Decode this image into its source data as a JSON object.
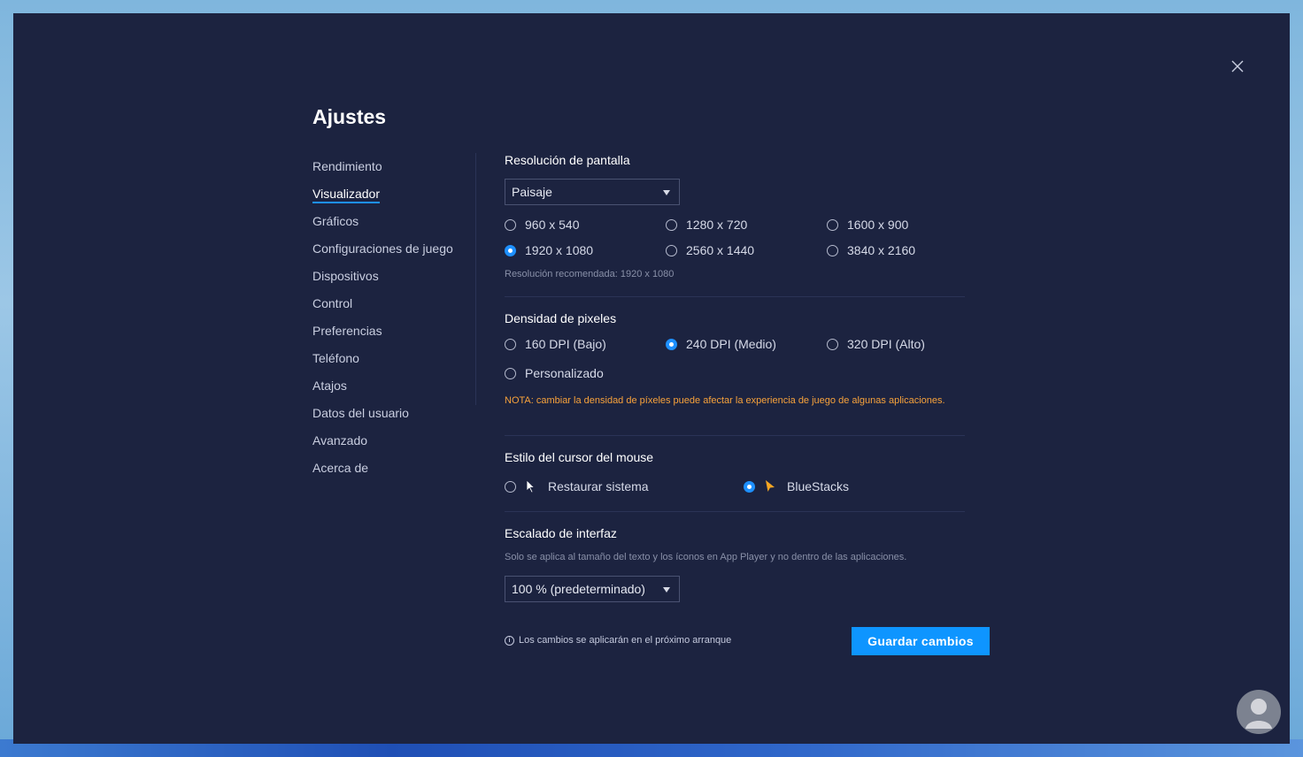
{
  "window": {
    "title": "Ajustes"
  },
  "sidebar": {
    "items": [
      {
        "label": "Rendimiento",
        "active": false
      },
      {
        "label": "Visualizador",
        "active": true
      },
      {
        "label": "Gráficos",
        "active": false
      },
      {
        "label": "Configuraciones de juego",
        "active": false
      },
      {
        "label": "Dispositivos",
        "active": false
      },
      {
        "label": "Control",
        "active": false
      },
      {
        "label": "Preferencias",
        "active": false
      },
      {
        "label": "Teléfono",
        "active": false
      },
      {
        "label": "Atajos",
        "active": false
      },
      {
        "label": "Datos del usuario",
        "active": false
      },
      {
        "label": "Avanzado",
        "active": false
      },
      {
        "label": "Acerca de",
        "active": false
      }
    ]
  },
  "resolution": {
    "title": "Resolución de pantalla",
    "orientation": "Paisaje",
    "options": [
      "960 x 540",
      "1280 x 720",
      "1600 x 900",
      "1920 x 1080",
      "2560 x 1440",
      "3840 x 2160"
    ],
    "selected": "1920 x 1080",
    "recommended": "Resolución recomendada: 1920 x 1080"
  },
  "density": {
    "title": "Densidad de pixeles",
    "options": [
      "160 DPI (Bajo)",
      "240 DPI (Medio)",
      "320 DPI (Alto)",
      "Personalizado"
    ],
    "selected": "240 DPI (Medio)",
    "note": "NOTA: cambiar la densidad de píxeles puede afectar la experiencia de juego de algunas aplicaciones."
  },
  "cursor": {
    "title": "Estilo del cursor del mouse",
    "options": [
      "Restaurar sistema",
      "BlueStacks"
    ],
    "selected": "BlueStacks"
  },
  "scaling": {
    "title": "Escalado de interfaz",
    "hint": "Solo se aplica al tamaño del texto y los íconos en App Player y no dentro de las aplicaciones.",
    "value": "100 % (predeterminado)"
  },
  "footer": {
    "info": "Los cambios se aplicarán en el próximo arranque",
    "save_label": "Guardar cambios"
  },
  "colors": {
    "background": "#1c2340",
    "accent": "#0e95ff",
    "warning": "#f7a23b",
    "bluestacks_cursor": "#f5a623"
  }
}
